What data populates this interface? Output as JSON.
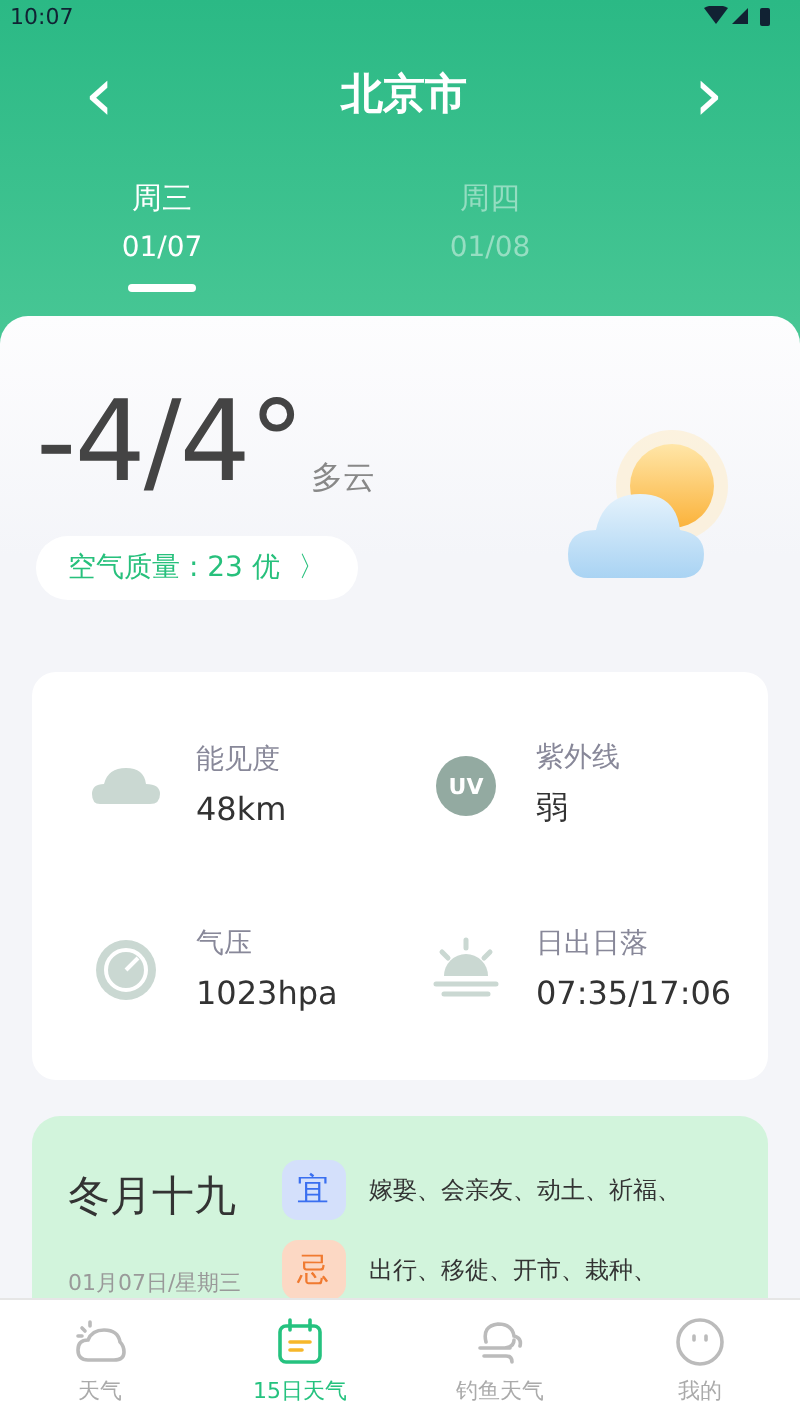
{
  "status_bar": {
    "time": "10:07"
  },
  "header": {
    "title": "北京市",
    "prev": "‹",
    "next": "›"
  },
  "day_tabs": [
    {
      "weekday": "周三",
      "date": "01/07",
      "selected": true
    },
    {
      "weekday": "周四",
      "date": "01/08",
      "selected": false
    }
  ],
  "today": {
    "temperature": "-4/4°",
    "condition": "多云",
    "air_quality": "空气质量 : 23 优",
    "air_arrow": "〉"
  },
  "details": [
    {
      "kind": "visibility",
      "label": "能见度",
      "value": "48km"
    },
    {
      "kind": "uv",
      "badge": "UV",
      "label": "紫外线",
      "value": "弱"
    },
    {
      "kind": "pressure",
      "label": "气压",
      "value": "1023hpa"
    },
    {
      "kind": "sunrise",
      "label": "日出日落",
      "value": "07:35/17:06"
    }
  ],
  "almanac": {
    "lunar_date": "冬月十九",
    "date": "01月07日/星期三",
    "rows": [
      {
        "kind": "good",
        "tag": "宜",
        "items": "嫁娶、会亲友、动土、祈福、"
      },
      {
        "kind": "bad",
        "tag": "忌",
        "items": "出行、移徙、开市、栽种、"
      }
    ]
  },
  "bottom_nav": [
    {
      "kind": "weather",
      "label": "天气",
      "selected": false
    },
    {
      "kind": "calendar",
      "label": "15日天气",
      "selected": true
    },
    {
      "kind": "fishing",
      "label": "钓鱼天气",
      "selected": false
    },
    {
      "kind": "profile",
      "label": "我的",
      "selected": false
    }
  ]
}
